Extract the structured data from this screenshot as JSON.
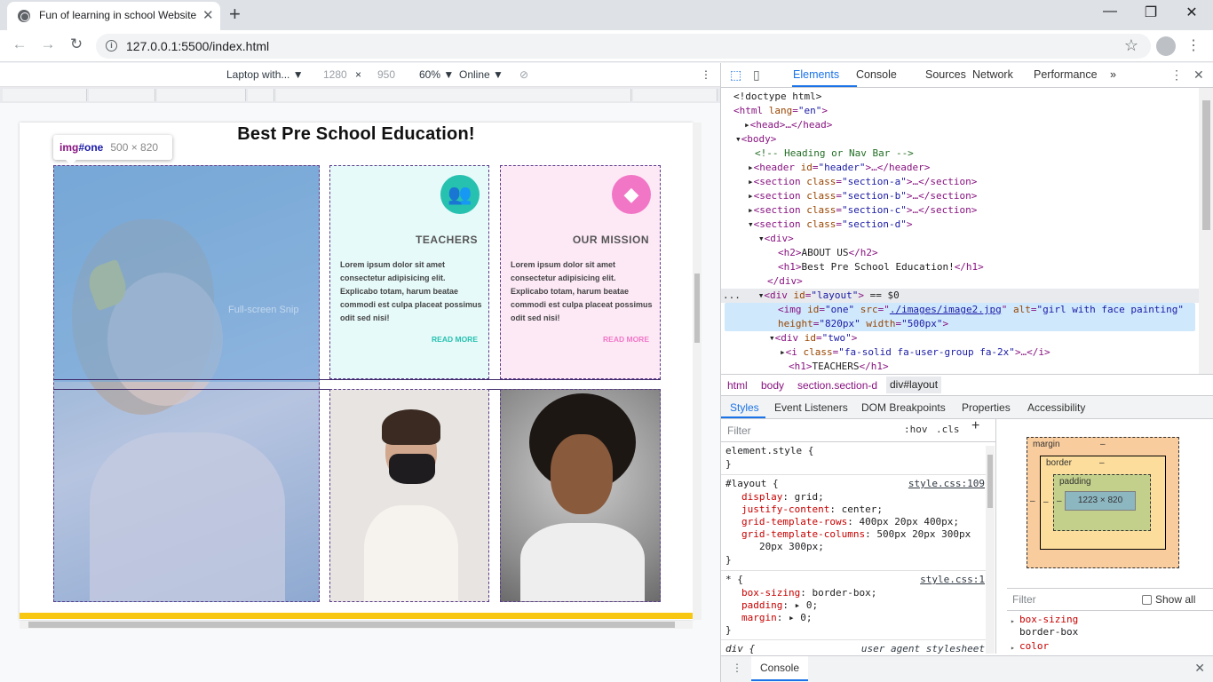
{
  "browser": {
    "tab_title": "Fun of learning in school Website",
    "tab_close": "✕",
    "new_tab": "+",
    "url": "127.0.0.1:5500/index.html",
    "back": "←",
    "forward": "→",
    "reload": "↻",
    "star": "☆",
    "menu": "⋮",
    "window": {
      "minimize": "—",
      "restore": "❐",
      "close": "✕"
    }
  },
  "device_toolbar": {
    "device": "Laptop with... ▼",
    "width": "1280",
    "times": "×",
    "height": "950",
    "zoom": "60% ▼",
    "network": "Online ▼",
    "rotate": "⊘",
    "menu": "⋮"
  },
  "page": {
    "title": "Best Pre School Education!",
    "snip_text": "Full-screen Snip",
    "tooltip": {
      "tag": "img",
      "id": "#one",
      "size": "500 × 820"
    },
    "cards": [
      {
        "heading": "TEACHERS",
        "icon": "users-icon",
        "icon_glyph": "👥",
        "text": "Lorem ipsum dolor sit amet consectetur adipisicing elit. Explicabo totam, harum beatae commodi est culpa placeat possimus odit sed nisi!",
        "link": "READ MORE",
        "accent": "#27c1b0"
      },
      {
        "heading": "OUR MISSION",
        "icon": "diamond-icon",
        "icon_glyph": "◆",
        "text": "Lorem ipsum dolor sit amet consectetur adipisicing elit. Explicabo totam, harum beatae commodi est culpa placeat possimus odit sed nisi!",
        "link": "READ MORE",
        "accent": "#f276c6"
      }
    ],
    "footer_accent": "#f7c712"
  },
  "devtools": {
    "tabs": [
      "Elements",
      "Console",
      "Sources",
      "Network",
      "Performance"
    ],
    "more_tabs": "»",
    "dom": {
      "doctype": "<!doctype html>",
      "html_open": "<html",
      "html_lang_attr": "lang",
      "html_lang_val": "\"en\"",
      "head": "<head>…</head>",
      "body": "<body>",
      "comment": "<!-- Heading or Nav Bar -->",
      "header": "<header",
      "header_id": "\"header\"",
      "header_close": ">…</header>",
      "section_a": "\"section-a\"",
      "section_b": "\"section-b\"",
      "section_c": "\"section-c\"",
      "section_d": "\"section-d\"",
      "section_close": ">…</section>",
      "div_open": "<div>",
      "h2": "ABOUT US",
      "h1": "Best Pre School Education!",
      "div_close": "</div>",
      "layout_id": "\"layout\"",
      "layout_suffix": "== $0",
      "img_id": "\"one\"",
      "img_src": "./images/image2.jpg",
      "img_alt": "\"girl with face painting\"",
      "img_height": "\"820px\"",
      "img_width": "\"500px\"",
      "two_id": "\"two\"",
      "icon_class": "\"fa-solid fa-user-group fa-2x\"",
      "icon_close": ">…</i>",
      "h1_teachers": "TEACHERS",
      "ellipsis": "..."
    },
    "breadcrumbs": [
      "html",
      "body",
      "section.section-d",
      "div#layout"
    ],
    "sub_tabs": [
      "Styles",
      "Event Listeners",
      "DOM Breakpoints",
      "Properties",
      "Accessibility"
    ],
    "styles": {
      "filter_placeholder": "Filter",
      "hov": ":hov",
      "cls": ".cls",
      "plus": "+",
      "element_style": "element.style {",
      "close_brace": "}",
      "layout_selector": "#layout {",
      "layout_source": "style.css:109",
      "layout_props": [
        {
          "name": "display",
          "value": "grid;"
        },
        {
          "name": "justify-content",
          "value": "center;"
        },
        {
          "name": "grid-template-rows",
          "value": "400px 20px 400px;"
        },
        {
          "name": "grid-template-columns",
          "value": "500px 20px 300px"
        }
      ],
      "layout_props_cont": "20px 300px;",
      "star_selector": "* {",
      "star_source": "style.css:1",
      "star_props": [
        {
          "name": "box-sizing",
          "value": "border-box;"
        },
        {
          "name": "padding",
          "value": "▸ 0;"
        },
        {
          "name": "margin",
          "value": "▸ 0;"
        }
      ],
      "div_selector": "div {",
      "div_source": "user agent stylesheet"
    },
    "box_model": {
      "margin": "margin",
      "border": "border",
      "padding": "padding",
      "dash": "–",
      "content": "1223 × 820"
    },
    "computed": {
      "filter_placeholder": "Filter",
      "show_all": "Show all",
      "items": [
        {
          "name": "box-sizing",
          "value": "border-box"
        },
        {
          "name": "color",
          "value": ""
        }
      ]
    },
    "drawer": {
      "tab": "Console",
      "dots": "⋮",
      "close": "✕"
    }
  }
}
